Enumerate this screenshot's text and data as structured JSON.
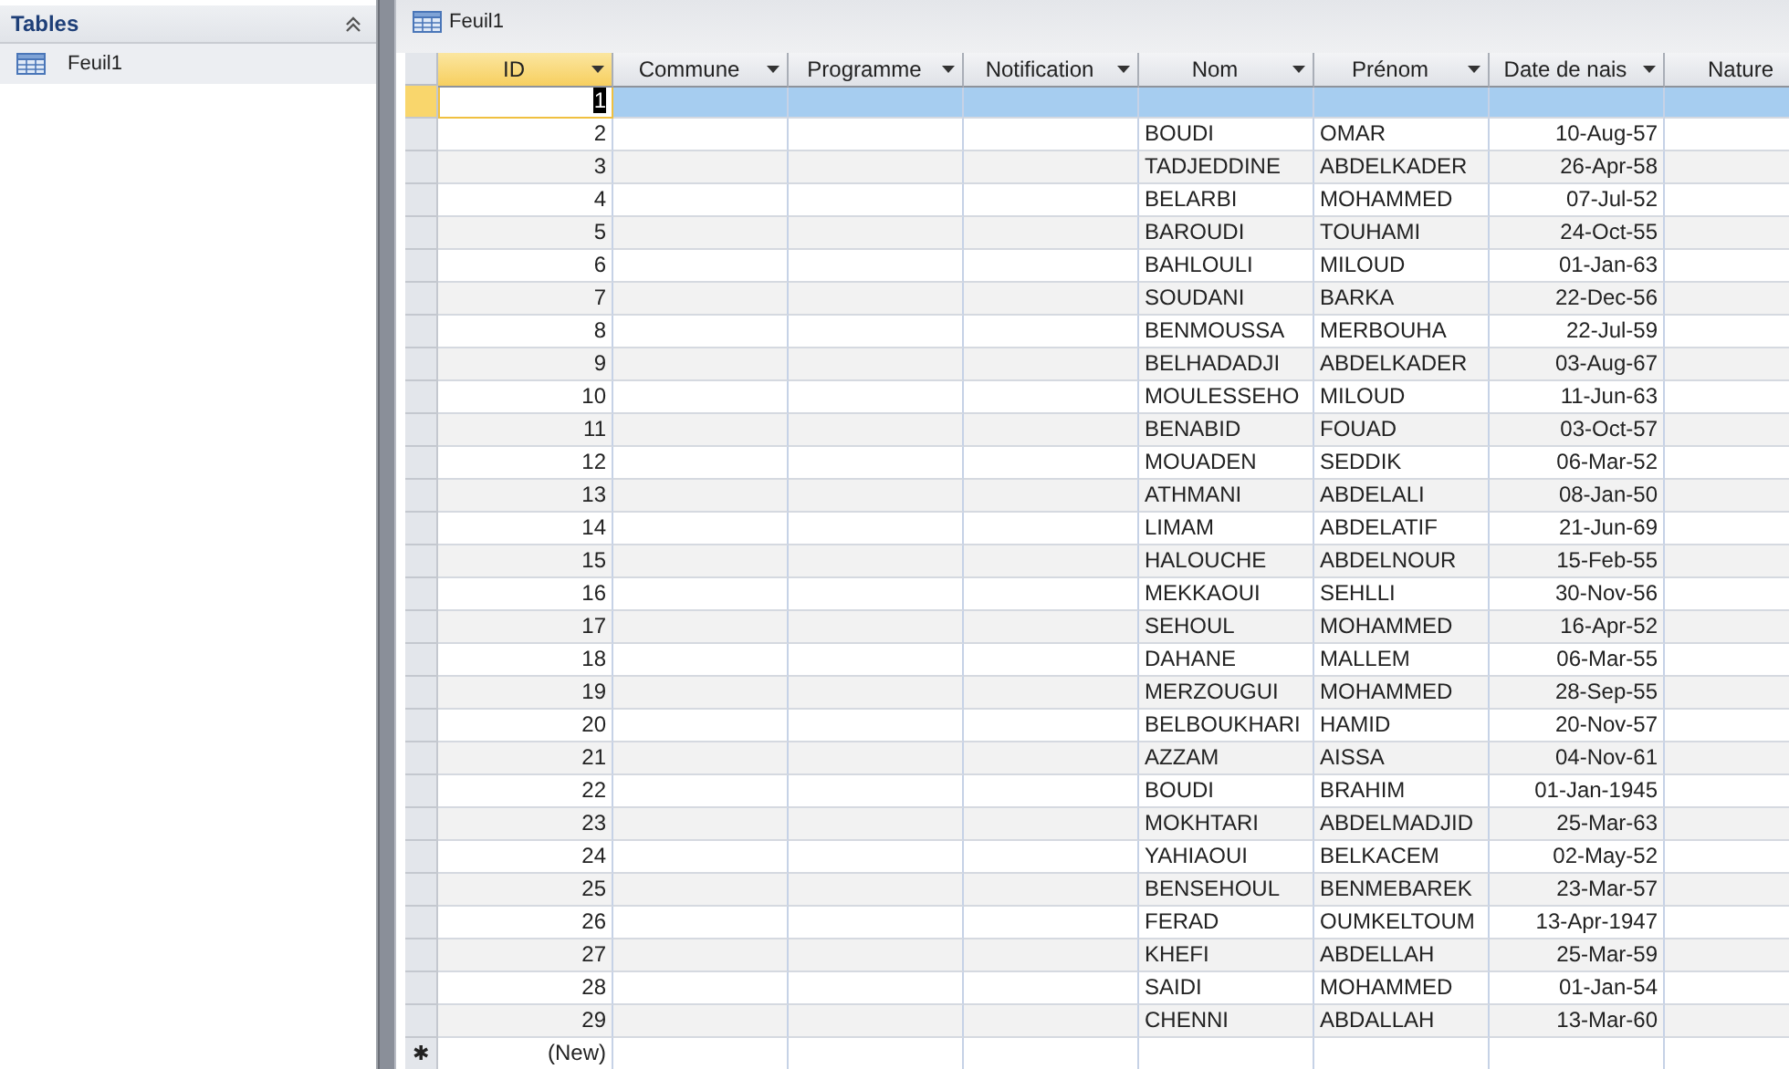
{
  "nav_pane": {
    "title": "Tables",
    "items": [
      {
        "label": "Feuil1"
      }
    ]
  },
  "document_tab": {
    "title": "Feuil1"
  },
  "table": {
    "columns": [
      {
        "label": "ID",
        "selected": true
      },
      {
        "label": "Commune",
        "selected": false
      },
      {
        "label": "Programme",
        "selected": false
      },
      {
        "label": "Notification",
        "selected": false
      },
      {
        "label": "Nom",
        "selected": false
      },
      {
        "label": "Prénom",
        "selected": false
      },
      {
        "label": "Date de nais",
        "selected": false
      },
      {
        "label": "Nature",
        "selected": false
      }
    ],
    "rows": [
      {
        "number": "1",
        "selected": true
      },
      {
        "number": "2",
        "nom": "BOUDI",
        "prenom": "OMAR",
        "date": "10-Aug-57",
        "selected": false
      },
      {
        "number": "3",
        "nom": "TADJEDDINE",
        "prenom": "ABDELKADER",
        "date": "26-Apr-58",
        "selected": false
      },
      {
        "number": "4",
        "nom": "BELARBI",
        "prenom": "MOHAMMED",
        "date": "07-Jul-52",
        "selected": false
      },
      {
        "number": "5",
        "nom": "BAROUDI",
        "prenom": "TOUHAMI",
        "date": "24-Oct-55",
        "selected": false
      },
      {
        "number": "6",
        "nom": "BAHLOULI",
        "prenom": "MILOUD",
        "date": "01-Jan-63",
        "selected": false
      },
      {
        "number": "7",
        "nom": "SOUDANI",
        "prenom": "BARKA",
        "date": "22-Dec-56",
        "selected": false
      },
      {
        "number": "8",
        "nom": "BENMOUSSA",
        "prenom": "MERBOUHA",
        "date": "22-Jul-59",
        "selected": false
      },
      {
        "number": "9",
        "nom": "BELHADADJI",
        "prenom": "ABDELKADER",
        "date": "03-Aug-67",
        "selected": false
      },
      {
        "number": "10",
        "nom": "MOULESSEHO",
        "prenom": "MILOUD",
        "date": "11-Jun-63",
        "selected": false
      },
      {
        "number": "11",
        "nom": "BENABID",
        "prenom": "FOUAD",
        "date": "03-Oct-57",
        "selected": false
      },
      {
        "number": "12",
        "nom": "MOUADEN",
        "prenom": "SEDDIK",
        "date": "06-Mar-52",
        "selected": false
      },
      {
        "number": "13",
        "nom": "ATHMANI",
        "prenom": "ABDELALI",
        "date": "08-Jan-50",
        "selected": false
      },
      {
        "number": "14",
        "nom": "LIMAM",
        "prenom": "ABDELATIF",
        "date": "21-Jun-69",
        "selected": false
      },
      {
        "number": "15",
        "nom": "HALOUCHE",
        "prenom": "ABDELNOUR",
        "date": "15-Feb-55",
        "selected": false
      },
      {
        "number": "16",
        "nom": "MEKKAOUI",
        "prenom": "SEHLLI",
        "date": "30-Nov-56",
        "selected": false
      },
      {
        "number": "17",
        "nom": "SEHOUL",
        "prenom": "MOHAMMED",
        "date": "16-Apr-52",
        "selected": false
      },
      {
        "number": "18",
        "nom": "DAHANE",
        "prenom": "MALLEM",
        "date": "06-Mar-55",
        "selected": false
      },
      {
        "number": "19",
        "nom": "MERZOUGUI",
        "prenom": "MOHAMMED",
        "date": "28-Sep-55",
        "selected": false
      },
      {
        "number": "20",
        "nom": "BELBOUKHARI",
        "prenom": "HAMID",
        "date": "20-Nov-57",
        "selected": false
      },
      {
        "number": "21",
        "nom": "AZZAM",
        "prenom": "AISSA",
        "date": "04-Nov-61",
        "selected": false
      },
      {
        "number": "22",
        "nom": "BOUDI",
        "prenom": "BRAHIM",
        "date": "01-Jan-1945",
        "selected": false
      },
      {
        "number": "23",
        "nom": "MOKHTARI",
        "prenom": "ABDELMADJID",
        "date": "25-Mar-63",
        "selected": false
      },
      {
        "number": "24",
        "nom": "YAHIAOUI",
        "prenom": "BELKACEM",
        "date": "02-May-52",
        "selected": false
      },
      {
        "number": "25",
        "nom": "BENSEHOUL",
        "prenom": "BENMEBAREK",
        "date": "23-Mar-57",
        "selected": false
      },
      {
        "number": "26",
        "nom": "FERAD",
        "prenom": "OUMKELTOUM",
        "date": "13-Apr-1947",
        "selected": false
      },
      {
        "number": "27",
        "nom": "KHEFI",
        "prenom": "ABDELLAH",
        "date": "25-Mar-59",
        "selected": false
      },
      {
        "number": "28",
        "nom": "SAIDI",
        "prenom": "MOHAMMED",
        "date": "01-Jan-54",
        "selected": false
      },
      {
        "number": "29",
        "nom": "CHENNI",
        "prenom": "ABDALLAH",
        "date": "13-Mar-60",
        "selected": false
      }
    ],
    "new_row": {
      "marker": "✱",
      "label": "(New)"
    }
  }
}
